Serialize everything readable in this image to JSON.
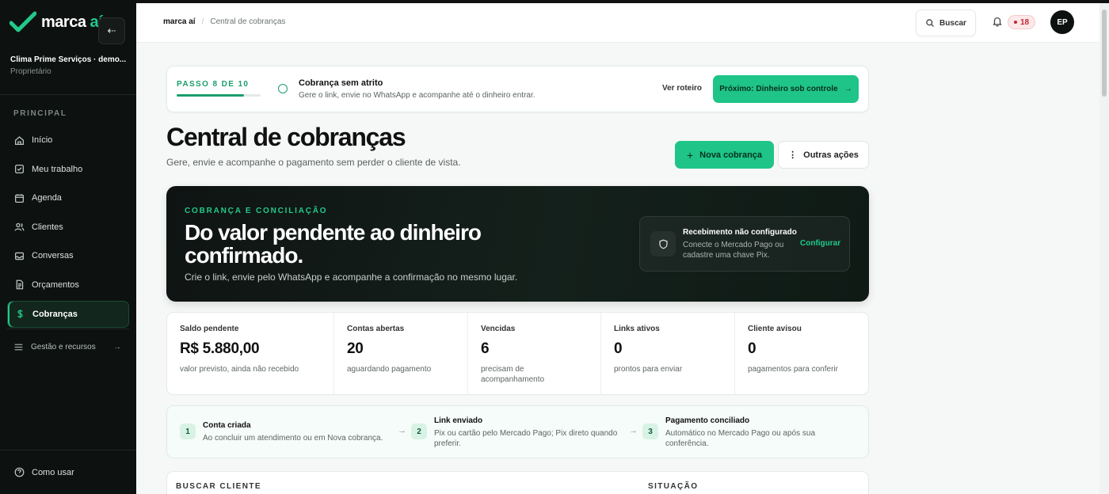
{
  "sidebar": {
    "logo_text": "marca",
    "logo_accent": "aí",
    "org_name": "Clima Prime Serviços · demo...",
    "org_role": "Proprietário",
    "section_label": "PRINCIPAL",
    "items": [
      {
        "label": "Início",
        "icon": "home-icon"
      },
      {
        "label": "Meu trabalho",
        "icon": "check-square-icon"
      },
      {
        "label": "Agenda",
        "icon": "calendar-icon"
      },
      {
        "label": "Clientes",
        "icon": "users-icon"
      },
      {
        "label": "Conversas",
        "icon": "inbox-icon"
      },
      {
        "label": "Orçamentos",
        "icon": "document-icon"
      },
      {
        "label": "Cobranças",
        "icon": "dollar-icon",
        "active": true
      }
    ],
    "secondary_label": "Gestão e recursos",
    "bottom_label": "Como usar"
  },
  "header": {
    "breadcrumb_root": "marca aí",
    "breadcrumb_sep": "/",
    "breadcrumb_current": "Central de cobranças",
    "search_label": "Buscar",
    "notifications_count": "18",
    "avatar_initials": "EP"
  },
  "onboarding": {
    "step_label": "PASSO 8 DE 10",
    "progress": 0.8,
    "title": "Cobrança sem atrito",
    "description": "Gere o link, envie no WhatsApp e acompanhe até o dinheiro entrar.",
    "guide_link": "Ver roteiro",
    "next_button": "Próximo: Dinheiro sob controle",
    "next_arrow": "→"
  },
  "page": {
    "title": "Central de cobranças",
    "subtitle": "Gere, envie e acompanhe o pagamento sem perder o cliente de vista.",
    "new_button": "Nova cobrança",
    "new_button_icon": "+",
    "other_button": "Outras ações",
    "other_button_icon": "⋮"
  },
  "hero": {
    "eyebrow": "COBRANÇA E CONCILIAÇÃO",
    "title": "Do valor pendente ao dinheiro confirmado.",
    "subtitle": "Crie o link, envie pelo WhatsApp e acompanhe a confirmação no mesmo lugar.",
    "box_title": "Recebimento não configurado",
    "box_desc": "Conecte o Mercado Pago ou cadastre uma chave Pix.",
    "box_link": "Configurar"
  },
  "stats": [
    {
      "label": "Saldo pendente",
      "value": "R$ 5.880,00",
      "note": "valor previsto, ainda não recebido"
    },
    {
      "label": "Contas abertas",
      "value": "20",
      "note": "aguardando pagamento"
    },
    {
      "label": "Vencidas",
      "value": "6",
      "note": "precisam de acompanhamento"
    },
    {
      "label": "Links ativos",
      "value": "0",
      "note": "prontos para enviar"
    },
    {
      "label": "Cliente avisou",
      "value": "0",
      "note": "pagamentos para conferir"
    }
  ],
  "process": [
    {
      "num": "1",
      "title": "Conta criada",
      "desc": "Ao concluir um atendimento ou em Nova cobrança."
    },
    {
      "num": "2",
      "title": "Link enviado",
      "desc": "Pix ou cartão pelo Mercado Pago; Pix direto quando preferir."
    },
    {
      "num": "3",
      "title": "Pagamento conciliado",
      "desc": "Automático no Mercado Pago ou após sua conferência."
    }
  ],
  "process_arrow": "→",
  "filters": {
    "search_label": "BUSCAR CLIENTE",
    "status_label": "SITUAÇÃO"
  },
  "colors": {
    "accent": "#1fc488",
    "sidebar_bg": "#0d1110",
    "danger": "#c4262e"
  }
}
